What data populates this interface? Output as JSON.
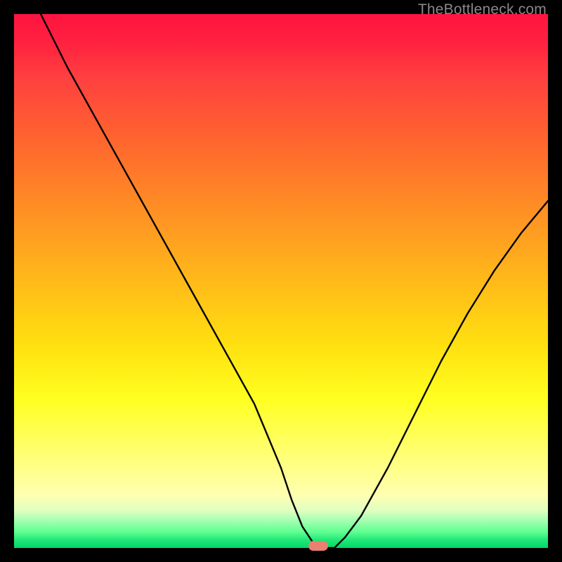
{
  "watermark": "TheBottleneck.com",
  "chart_data": {
    "type": "line",
    "title": "",
    "xlabel": "",
    "ylabel": "",
    "x_range": [
      0,
      100
    ],
    "y_range": [
      0,
      100
    ],
    "series": [
      {
        "name": "curve",
        "x": [
          5,
          10,
          15,
          20,
          25,
          30,
          35,
          40,
          45,
          50,
          52,
          54,
          56,
          57,
          58,
          60,
          62,
          65,
          70,
          75,
          80,
          85,
          90,
          95,
          100
        ],
        "y": [
          100,
          90,
          81,
          72,
          63,
          54,
          45,
          36,
          27,
          15,
          9,
          4,
          1,
          0,
          0,
          0,
          2,
          6,
          15,
          25,
          35,
          44,
          52,
          59,
          65
        ]
      }
    ],
    "marker": {
      "x_pct": 57,
      "y_pct": 0
    }
  }
}
